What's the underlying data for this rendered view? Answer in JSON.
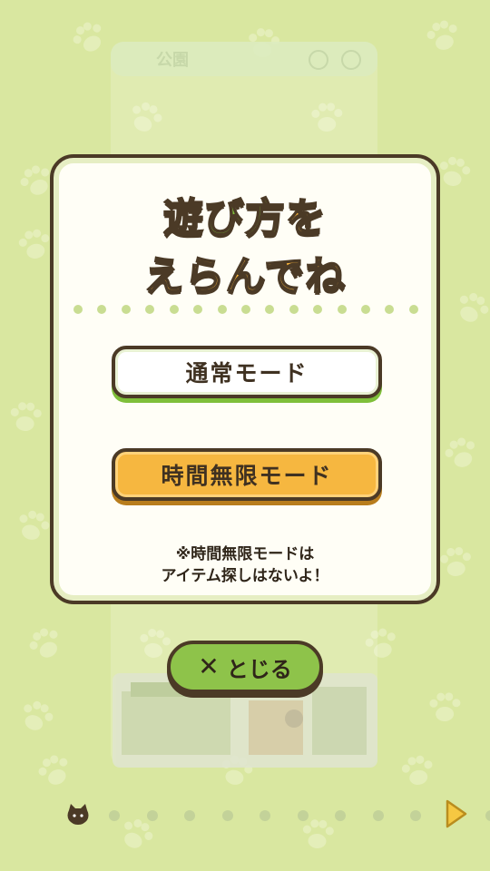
{
  "background_screen": {
    "header_title": "公園"
  },
  "modal": {
    "title_line1_main": "遊び方",
    "title_line1_accent": "を",
    "title_line2": "えらんでね",
    "normal_mode_label": "通常モード",
    "unlimited_mode_label": "時間無限モード",
    "note_line1": "※時間無限モードは",
    "note_line2": "アイテム探しはないよ！"
  },
  "close_button": {
    "label": "とじる"
  },
  "pagination": {
    "current": 1,
    "total": 12
  },
  "colors": {
    "background": "#d9e7a0",
    "accent_green": "#7fbf3a",
    "accent_orange": "#f6b740",
    "outline_brown": "#4b3a26"
  },
  "icons": [
    "paw-icon",
    "close-x-icon",
    "cat-face-icon",
    "next-arrow-icon"
  ]
}
